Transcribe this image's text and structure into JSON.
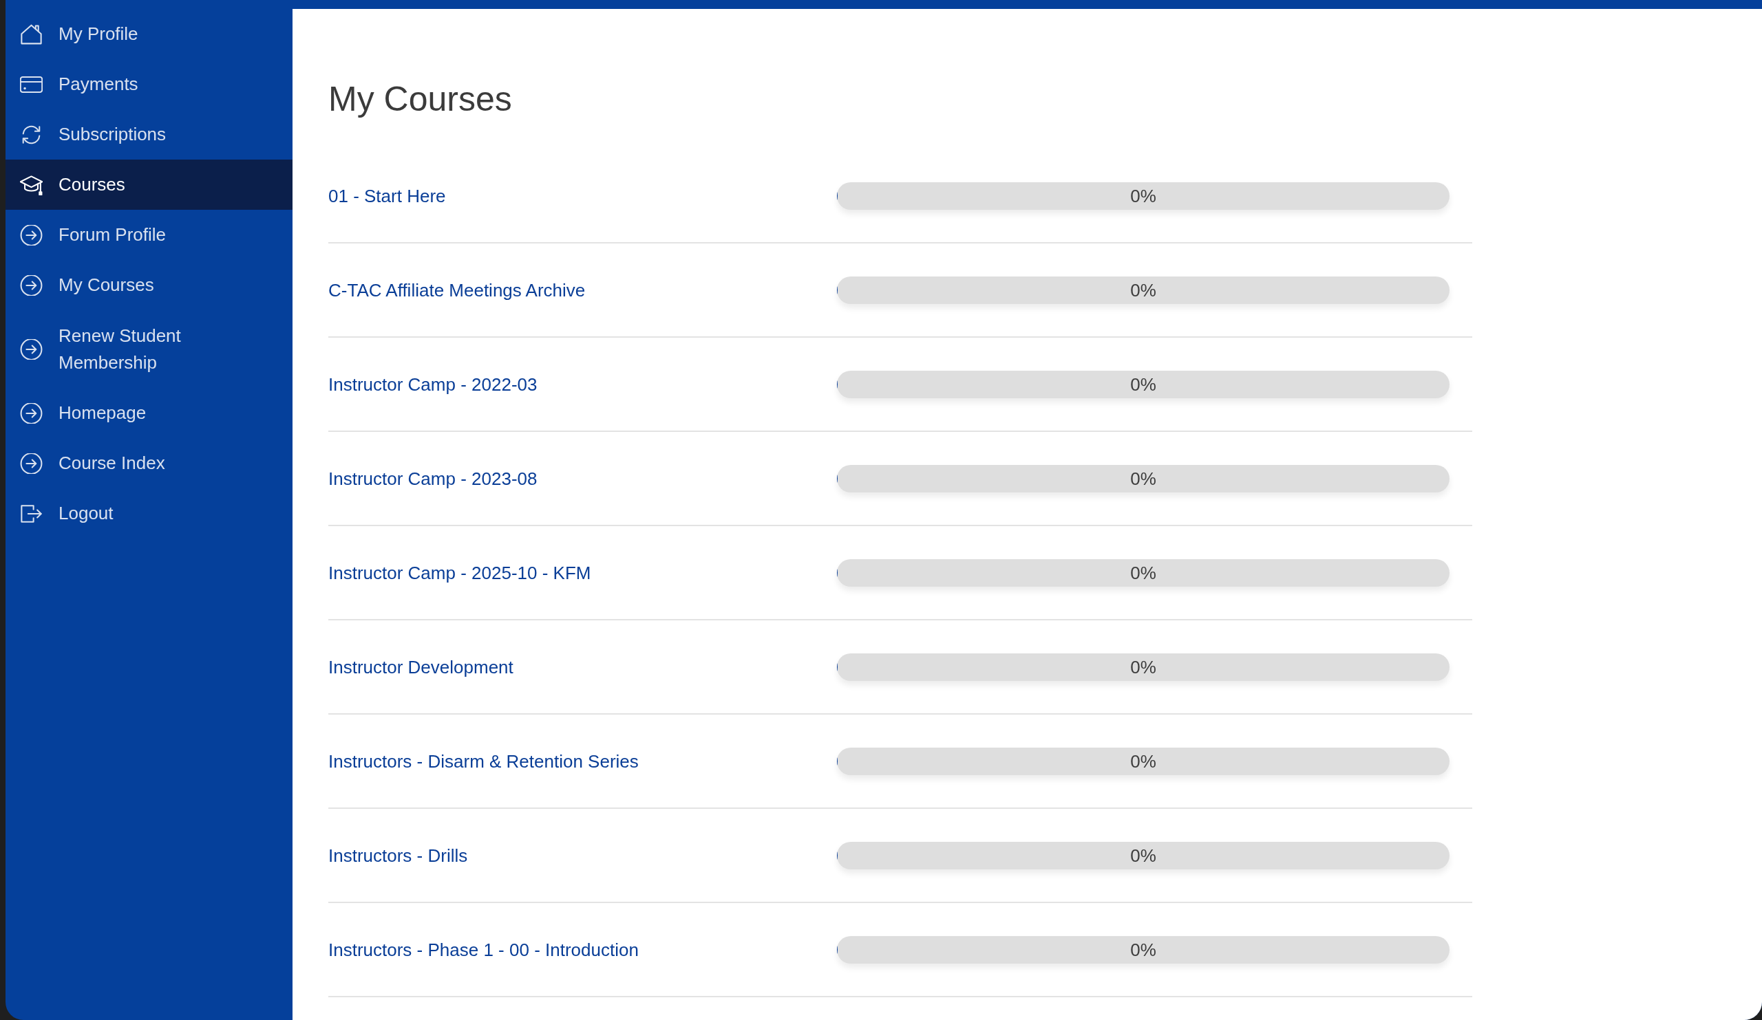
{
  "sidebar": {
    "items": [
      {
        "label": "My Profile",
        "kind": "profile",
        "selected": false
      },
      {
        "label": "Payments",
        "kind": "payments",
        "selected": false
      },
      {
        "label": "Subscriptions",
        "kind": "subscriptions",
        "selected": false
      },
      {
        "label": "Courses",
        "kind": "courses",
        "selected": true
      },
      {
        "label": "Forum Profile",
        "kind": "link",
        "selected": false
      },
      {
        "label": "My Courses",
        "kind": "link",
        "selected": false
      },
      {
        "label": "Renew Student Membership",
        "kind": "link",
        "selected": false
      },
      {
        "label": "Homepage",
        "kind": "link",
        "selected": false
      },
      {
        "label": "Course Index",
        "kind": "link",
        "selected": false
      },
      {
        "label": "Logout",
        "kind": "logout",
        "selected": false
      }
    ]
  },
  "main": {
    "title": "My Courses",
    "courses": [
      {
        "title": "01 - Start Here",
        "level": 0,
        "reading": "0%"
      },
      {
        "title": "C-TAC Affiliate Meetings Archive",
        "level": 0,
        "reading": "0%"
      },
      {
        "title": "Instructor Camp - 2022-03",
        "level": 0,
        "reading": "0%"
      },
      {
        "title": "Instructor Camp - 2023-08",
        "level": 0,
        "reading": "0%"
      },
      {
        "title": "Instructor Camp - 2025-10 - KFM",
        "level": 0,
        "reading": "0%"
      },
      {
        "title": "Instructor Development",
        "level": 0,
        "reading": "0%"
      },
      {
        "title": "Instructors - Disarm & Retention Series",
        "level": 0,
        "reading": "0%"
      },
      {
        "title": "Instructors - Drills",
        "level": 0,
        "reading": "0%"
      },
      {
        "title": "Instructors - Phase 1 - 00 - Introduction",
        "level": 0,
        "reading": "0%"
      }
    ]
  }
}
